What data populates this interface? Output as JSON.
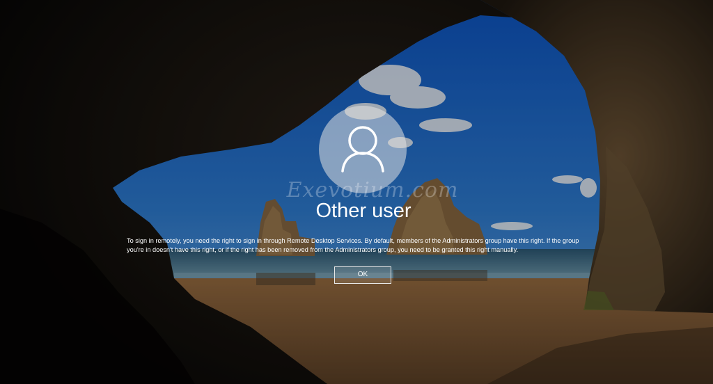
{
  "login": {
    "username": "Other user",
    "watermark": "Exevotium.com",
    "message": "To sign in remotely, you need the right to sign in through Remote Desktop Services. By default, members of the Administrators group have this right. If the group you're in doesn't have this right, or if the right has been removed from the Administrators group, you need to be granted this right manually.",
    "ok_label": "OK",
    "avatar_icon": "user-icon"
  },
  "colors": {
    "sky_top": "#0e57c4",
    "sky_bottom": "#4f9be0",
    "sea": "#3f6f86",
    "sand": "#a87a48",
    "rock": "#3a2e22"
  }
}
